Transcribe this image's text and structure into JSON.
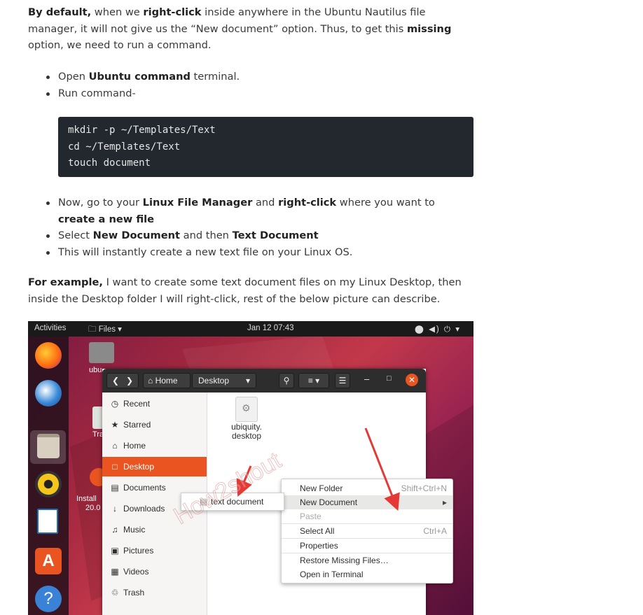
{
  "article": {
    "p1": {
      "b1": "By default,",
      "t1": " when we ",
      "b2": "right-click",
      "t2": " inside anywhere in the Ubuntu Nautilus file manager, it will not give us the “New document” option. Thus, to get this ",
      "b3": "missing",
      "t3": " option, we need to run a command."
    },
    "list1": [
      {
        "pre": "Open ",
        "bold": "Ubuntu command",
        "post": " terminal."
      },
      {
        "pre": "Run command-",
        "bold": "",
        "post": ""
      }
    ],
    "code": [
      "mkdir -p ~/Templates/Text",
      "cd ~/Templates/Text",
      "touch document"
    ],
    "list2": {
      "i1": {
        "t1": "Now, go to your ",
        "b1": "Linux File Manager",
        "t2": " and ",
        "b2": "right-click",
        "t3": " where you want to ",
        "b3": "create a new file"
      },
      "i2": {
        "t1": "Select ",
        "b1": "New Document",
        "t2": " and then ",
        "b2": "Text Document"
      },
      "i3": {
        "t1": "This will instantly create a new text file on your Linux OS."
      }
    },
    "p2": {
      "b1": "For example,",
      "t1": " I want to create some text document files on my Linux Desktop, then inside the Desktop folder I will right-click, rest of the below picture can describe."
    }
  },
  "screenshot": {
    "topbar": {
      "activities": "Activities",
      "files": "Files ▾",
      "clock": "Jan 12  07:43",
      "tray": "⬤ ◀) ⏻ ▾"
    },
    "desktop_icons": {
      "home_label": "ubu",
      "trash_label": "Tra",
      "install_label": "Install",
      "install_version": "20.0"
    },
    "header": {
      "home": "Home",
      "path": "Desktop"
    },
    "sidebar": [
      {
        "icon": "◷",
        "label": "Recent"
      },
      {
        "icon": "★",
        "label": "Starred"
      },
      {
        "icon": "⌂",
        "label": "Home"
      },
      {
        "icon": "□",
        "label": "Desktop"
      },
      {
        "icon": "▤",
        "label": "Documents"
      },
      {
        "icon": "↓",
        "label": "Downloads"
      },
      {
        "icon": "♫",
        "label": "Music"
      },
      {
        "icon": "▣",
        "label": "Pictures"
      },
      {
        "icon": "▦",
        "label": "Videos"
      },
      {
        "icon": "♲",
        "label": "Trash"
      }
    ],
    "file": {
      "name_line1": "ubiquity.",
      "name_line2": "desktop"
    },
    "context_menu": [
      {
        "label": "New Folder",
        "shortcut": "Shift+Ctrl+N"
      },
      {
        "label": "New Document",
        "shortcut": "▸"
      },
      {
        "label": "Paste",
        "shortcut": ""
      },
      {
        "label": "Select All",
        "shortcut": "Ctrl+A"
      },
      {
        "label": "Properties",
        "shortcut": ""
      },
      {
        "label": "Restore Missing Files…",
        "shortcut": ""
      },
      {
        "label": "Open in Terminal",
        "shortcut": ""
      }
    ],
    "submenu": {
      "label": "text document"
    },
    "watermark": "How2shout",
    "colors": {
      "accent": "#e95420",
      "arrow": "#e53935"
    }
  }
}
